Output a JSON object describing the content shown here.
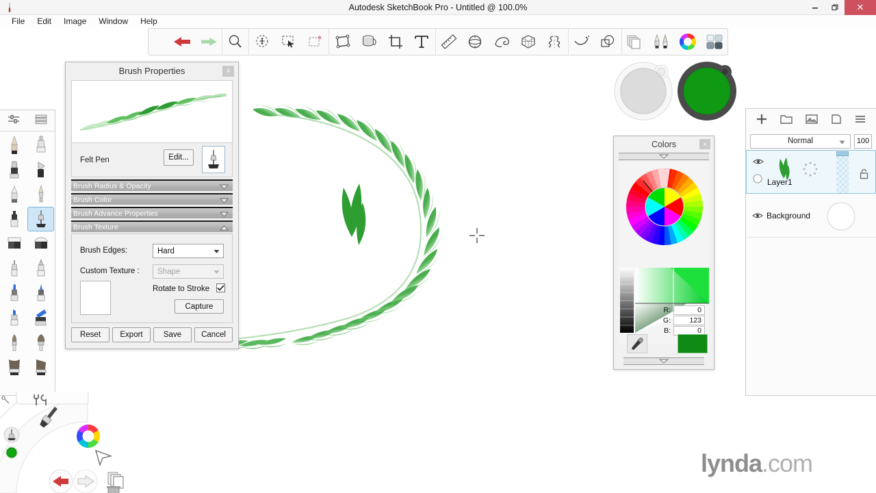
{
  "window": {
    "title": "Autodesk SketchBook Pro - Untitled @ 100.0%",
    "logo_icon": "sketchbook-app-icon",
    "minimize_label": "–",
    "restore_label": "❐",
    "close_label": "✕"
  },
  "menubar": {
    "items": [
      {
        "label": "File"
      },
      {
        "label": "Edit"
      },
      {
        "label": "Image"
      },
      {
        "label": "Window"
      },
      {
        "label": "Help"
      }
    ]
  },
  "toolbar": {
    "groups": [
      {
        "items": [
          {
            "name": "undo-icon",
            "title": "Undo"
          },
          {
            "name": "redo-icon",
            "title": "Redo"
          }
        ]
      },
      {
        "items": [
          {
            "name": "zoom-icon",
            "title": "Zoom"
          }
        ]
      },
      {
        "items": [
          {
            "name": "lasso-select-icon",
            "title": "Lasso Select"
          },
          {
            "name": "rectangle-select-icon",
            "title": "Rectangle Select"
          },
          {
            "name": "deselect-icon",
            "title": "Deselect"
          }
        ]
      },
      {
        "items": [
          {
            "name": "transform-icon",
            "title": "Transform"
          },
          {
            "name": "paint-bucket-icon",
            "title": "Fill"
          },
          {
            "name": "crop-icon",
            "title": "Crop"
          },
          {
            "name": "text-icon",
            "title": "Text"
          }
        ]
      },
      {
        "items": [
          {
            "name": "ruler-icon",
            "title": "Ruler"
          },
          {
            "name": "ellipse-guide-icon",
            "title": "Ellipse"
          },
          {
            "name": "french-curve-icon",
            "title": "French Curve"
          },
          {
            "name": "perspective-guide-icon",
            "title": "Perspective"
          },
          {
            "name": "symmetry-icon",
            "title": "Symmetry"
          }
        ]
      },
      {
        "items": [
          {
            "name": "predictive-stroke-icon",
            "title": "Predictive Stroke"
          },
          {
            "name": "shapes-icon",
            "title": "Shapes"
          }
        ]
      },
      {
        "items": [
          {
            "name": "layers-panel-icon",
            "title": "Layer Editor"
          },
          {
            "name": "brush-palette-icon",
            "title": "Brush Palette"
          },
          {
            "name": "color-wheel-icon",
            "title": "Color Editor"
          },
          {
            "name": "ui-toggle-icon",
            "title": "Toggle UI"
          }
        ]
      }
    ]
  },
  "brush_palette": {
    "header": [
      {
        "name": "brush-settings-icon",
        "title": "Brush Settings"
      },
      {
        "name": "list-view-icon",
        "title": "List View"
      }
    ],
    "brushes": [
      {
        "name": "pencil-brush",
        "selected": false
      },
      {
        "name": "airbrush-brush",
        "selected": false
      },
      {
        "name": "marker-brush",
        "selected": false
      },
      {
        "name": "chisel-marker-brush",
        "selected": false
      },
      {
        "name": "soft-pencil-brush",
        "selected": false
      },
      {
        "name": "nib-pen-brush",
        "selected": false
      },
      {
        "name": "felt-marker-brush",
        "selected": false
      },
      {
        "name": "felt-pen-brush",
        "selected": true
      },
      {
        "name": "eraser-hard-brush",
        "selected": false
      },
      {
        "name": "eraser-soft-brush",
        "selected": false
      },
      {
        "name": "ballpoint-brush",
        "selected": false
      },
      {
        "name": "technical-pen-brush",
        "selected": false
      },
      {
        "name": "blue-marker-brush",
        "selected": false
      },
      {
        "name": "blue-fine-marker-brush",
        "selected": false
      },
      {
        "name": "blue-chisel-brush",
        "selected": false
      },
      {
        "name": "blue-flat-brush",
        "selected": false
      },
      {
        "name": "round-bristle-brush",
        "selected": false
      },
      {
        "name": "fan-bristle-brush",
        "selected": false
      },
      {
        "name": "flat-bristle-brush",
        "selected": false
      },
      {
        "name": "angled-bristle-brush",
        "selected": false
      }
    ]
  },
  "brush_properties": {
    "title": "Brush Properties",
    "close_label": "x",
    "brush_name": "Felt Pen",
    "edit_label": "Edit...",
    "tool_icon": "felt-pen-icon",
    "sections": [
      {
        "label": "Brush Radius & Opacity",
        "expanded": false
      },
      {
        "label": "Brush Color",
        "expanded": false
      },
      {
        "label": "Brush Advance Properties",
        "expanded": false
      },
      {
        "label": "Brush Texture",
        "expanded": true
      }
    ],
    "texture": {
      "brush_edges_label": "Brush Edges:",
      "brush_edges_value": "Hard",
      "custom_texture_label": "Custom Texture :",
      "custom_texture_value": "Shape",
      "custom_texture_disabled": true,
      "rotate_to_stroke_label": "Rotate to Stroke",
      "rotate_to_stroke_checked": true,
      "capture_label": "Capture"
    },
    "footer": [
      {
        "label": "Reset"
      },
      {
        "label": "Export"
      },
      {
        "label": "Save"
      },
      {
        "label": "Cancel"
      }
    ]
  },
  "colors_panel": {
    "title": "Colors",
    "close_label": "x",
    "rgb": [
      {
        "label": "R:",
        "value": "0"
      },
      {
        "label": "G:",
        "value": "123"
      },
      {
        "label": "B:",
        "value": "0"
      }
    ],
    "current_color": "#0f8a14",
    "eyedropper_icon": "eyedropper-icon",
    "collapse_top_icon": "chevron-down-icon",
    "collapse_bottom_icon": "chevron-down-icon"
  },
  "layers_panel": {
    "tools": [
      {
        "name": "add-layer-icon",
        "label": "+"
      },
      {
        "name": "add-group-icon",
        "label": ""
      },
      {
        "name": "import-image-icon",
        "label": ""
      },
      {
        "name": "duplicate-layer-icon",
        "label": ""
      },
      {
        "name": "layer-menu-icon",
        "label": ""
      }
    ],
    "blend_mode": "Normal",
    "blend_chevron_icon": "chevron-down-icon",
    "opacity": "100",
    "layers": [
      {
        "name": "Layer1",
        "selected": true,
        "visible": true,
        "locked": false
      },
      {
        "name": "Background",
        "selected": false,
        "visible": true,
        "locked": false
      }
    ]
  },
  "color_pucks": [
    {
      "name": "background-color-puck",
      "color": "#d6d6d6",
      "active": false
    },
    {
      "name": "foreground-color-puck",
      "color": "#109a14",
      "active": true
    }
  ],
  "canvas": {
    "cursor_icon": "crosshair-cursor",
    "stroke_color": "#4caf50",
    "leaf_color": "#2e9e32"
  },
  "lagoon": {
    "items": [
      {
        "name": "brush-tool-icon"
      },
      {
        "name": "color-wheel-icon"
      },
      {
        "name": "cursor-tool-icon"
      },
      {
        "name": "layers-icon"
      },
      {
        "name": "undo-icon"
      },
      {
        "name": "redo-icon"
      },
      {
        "name": "trash-icon"
      },
      {
        "name": "tools-icon"
      },
      {
        "name": "current-brush-indicator"
      },
      {
        "name": "current-color-indicator"
      }
    ]
  },
  "watermark": {
    "bold": "lynda",
    "light": ".com"
  }
}
